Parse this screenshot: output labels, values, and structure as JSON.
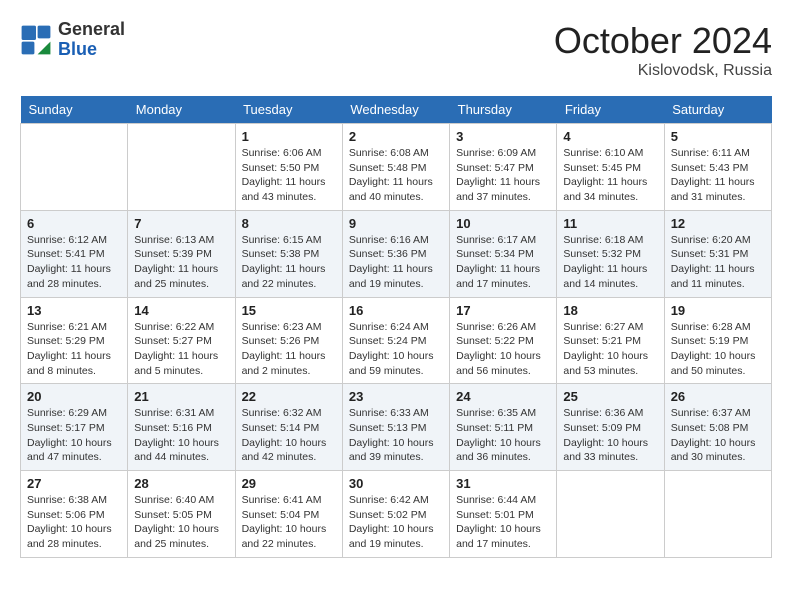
{
  "header": {
    "logo_general": "General",
    "logo_blue": "Blue",
    "month": "October 2024",
    "location": "Kislovodsk, Russia"
  },
  "weekdays": [
    "Sunday",
    "Monday",
    "Tuesday",
    "Wednesday",
    "Thursday",
    "Friday",
    "Saturday"
  ],
  "weeks": [
    [
      {
        "day": "",
        "info": ""
      },
      {
        "day": "",
        "info": ""
      },
      {
        "day": "1",
        "info": "Sunrise: 6:06 AM\nSunset: 5:50 PM\nDaylight: 11 hours and 43 minutes."
      },
      {
        "day": "2",
        "info": "Sunrise: 6:08 AM\nSunset: 5:48 PM\nDaylight: 11 hours and 40 minutes."
      },
      {
        "day": "3",
        "info": "Sunrise: 6:09 AM\nSunset: 5:47 PM\nDaylight: 11 hours and 37 minutes."
      },
      {
        "day": "4",
        "info": "Sunrise: 6:10 AM\nSunset: 5:45 PM\nDaylight: 11 hours and 34 minutes."
      },
      {
        "day": "5",
        "info": "Sunrise: 6:11 AM\nSunset: 5:43 PM\nDaylight: 11 hours and 31 minutes."
      }
    ],
    [
      {
        "day": "6",
        "info": "Sunrise: 6:12 AM\nSunset: 5:41 PM\nDaylight: 11 hours and 28 minutes."
      },
      {
        "day": "7",
        "info": "Sunrise: 6:13 AM\nSunset: 5:39 PM\nDaylight: 11 hours and 25 minutes."
      },
      {
        "day": "8",
        "info": "Sunrise: 6:15 AM\nSunset: 5:38 PM\nDaylight: 11 hours and 22 minutes."
      },
      {
        "day": "9",
        "info": "Sunrise: 6:16 AM\nSunset: 5:36 PM\nDaylight: 11 hours and 19 minutes."
      },
      {
        "day": "10",
        "info": "Sunrise: 6:17 AM\nSunset: 5:34 PM\nDaylight: 11 hours and 17 minutes."
      },
      {
        "day": "11",
        "info": "Sunrise: 6:18 AM\nSunset: 5:32 PM\nDaylight: 11 hours and 14 minutes."
      },
      {
        "day": "12",
        "info": "Sunrise: 6:20 AM\nSunset: 5:31 PM\nDaylight: 11 hours and 11 minutes."
      }
    ],
    [
      {
        "day": "13",
        "info": "Sunrise: 6:21 AM\nSunset: 5:29 PM\nDaylight: 11 hours and 8 minutes."
      },
      {
        "day": "14",
        "info": "Sunrise: 6:22 AM\nSunset: 5:27 PM\nDaylight: 11 hours and 5 minutes."
      },
      {
        "day": "15",
        "info": "Sunrise: 6:23 AM\nSunset: 5:26 PM\nDaylight: 11 hours and 2 minutes."
      },
      {
        "day": "16",
        "info": "Sunrise: 6:24 AM\nSunset: 5:24 PM\nDaylight: 10 hours and 59 minutes."
      },
      {
        "day": "17",
        "info": "Sunrise: 6:26 AM\nSunset: 5:22 PM\nDaylight: 10 hours and 56 minutes."
      },
      {
        "day": "18",
        "info": "Sunrise: 6:27 AM\nSunset: 5:21 PM\nDaylight: 10 hours and 53 minutes."
      },
      {
        "day": "19",
        "info": "Sunrise: 6:28 AM\nSunset: 5:19 PM\nDaylight: 10 hours and 50 minutes."
      }
    ],
    [
      {
        "day": "20",
        "info": "Sunrise: 6:29 AM\nSunset: 5:17 PM\nDaylight: 10 hours and 47 minutes."
      },
      {
        "day": "21",
        "info": "Sunrise: 6:31 AM\nSunset: 5:16 PM\nDaylight: 10 hours and 44 minutes."
      },
      {
        "day": "22",
        "info": "Sunrise: 6:32 AM\nSunset: 5:14 PM\nDaylight: 10 hours and 42 minutes."
      },
      {
        "day": "23",
        "info": "Sunrise: 6:33 AM\nSunset: 5:13 PM\nDaylight: 10 hours and 39 minutes."
      },
      {
        "day": "24",
        "info": "Sunrise: 6:35 AM\nSunset: 5:11 PM\nDaylight: 10 hours and 36 minutes."
      },
      {
        "day": "25",
        "info": "Sunrise: 6:36 AM\nSunset: 5:09 PM\nDaylight: 10 hours and 33 minutes."
      },
      {
        "day": "26",
        "info": "Sunrise: 6:37 AM\nSunset: 5:08 PM\nDaylight: 10 hours and 30 minutes."
      }
    ],
    [
      {
        "day": "27",
        "info": "Sunrise: 6:38 AM\nSunset: 5:06 PM\nDaylight: 10 hours and 28 minutes."
      },
      {
        "day": "28",
        "info": "Sunrise: 6:40 AM\nSunset: 5:05 PM\nDaylight: 10 hours and 25 minutes."
      },
      {
        "day": "29",
        "info": "Sunrise: 6:41 AM\nSunset: 5:04 PM\nDaylight: 10 hours and 22 minutes."
      },
      {
        "day": "30",
        "info": "Sunrise: 6:42 AM\nSunset: 5:02 PM\nDaylight: 10 hours and 19 minutes."
      },
      {
        "day": "31",
        "info": "Sunrise: 6:44 AM\nSunset: 5:01 PM\nDaylight: 10 hours and 17 minutes."
      },
      {
        "day": "",
        "info": ""
      },
      {
        "day": "",
        "info": ""
      }
    ]
  ]
}
